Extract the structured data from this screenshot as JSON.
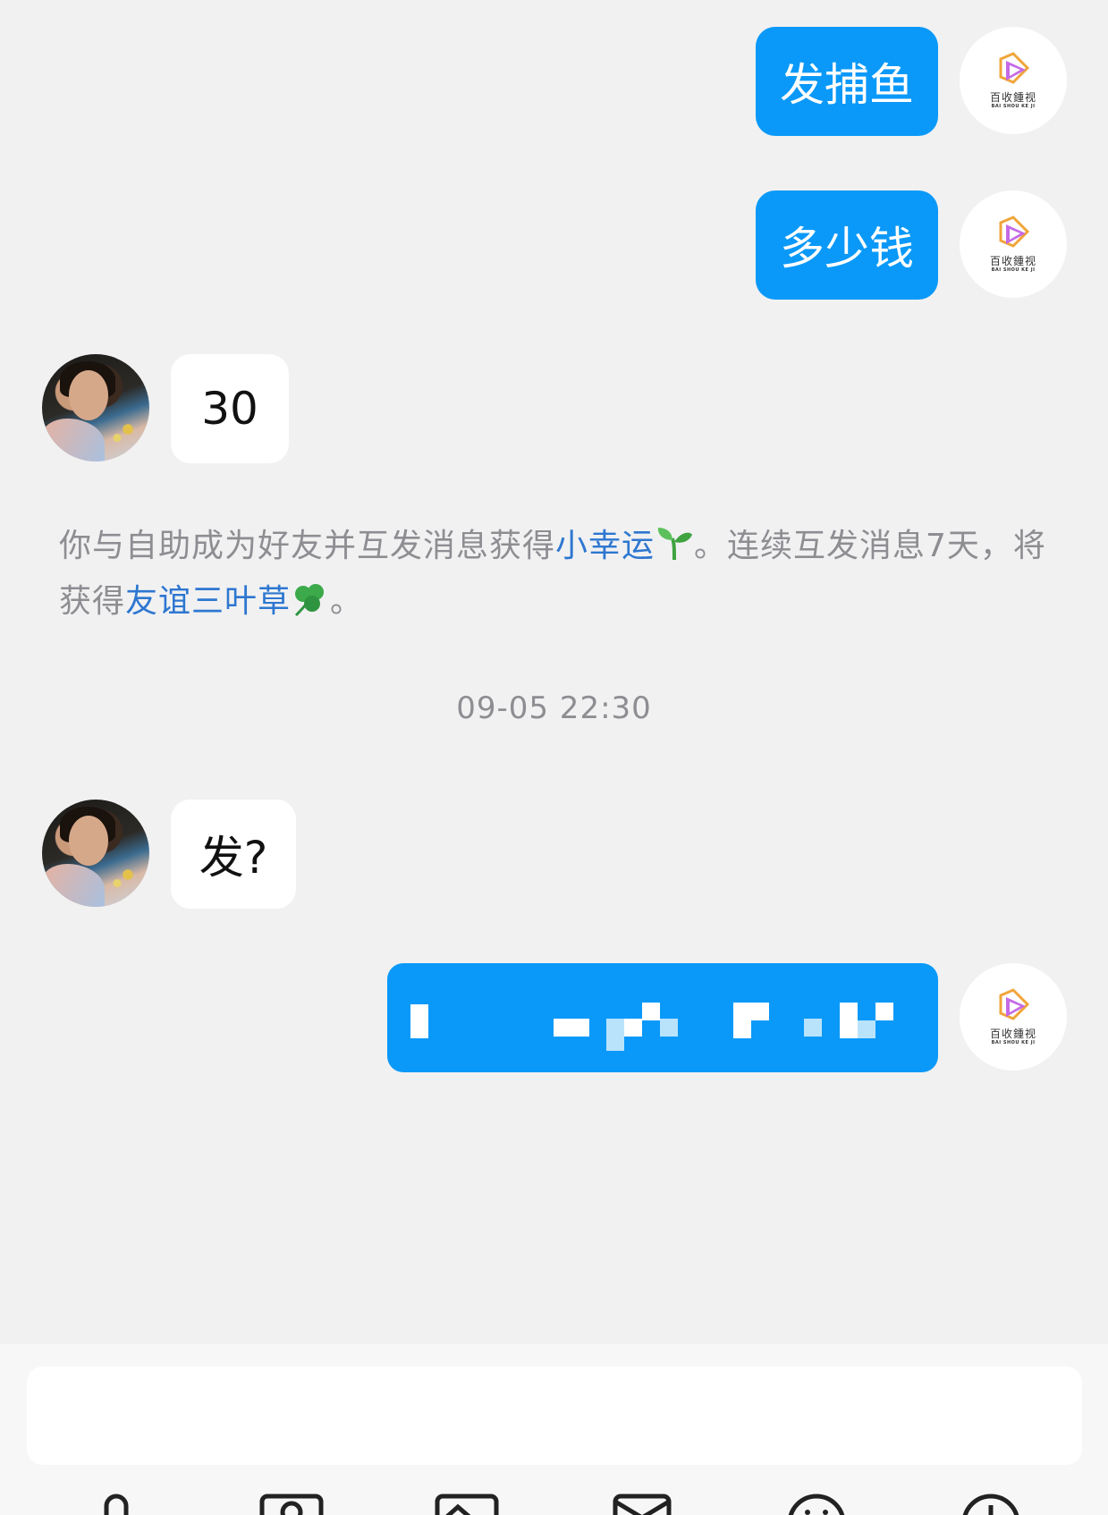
{
  "messages": [
    {
      "side": "outgoing",
      "text": "发捕鱼"
    },
    {
      "side": "outgoing",
      "text": "多少钱"
    },
    {
      "side": "incoming",
      "text": "30"
    },
    {
      "side": "incoming",
      "text": "发?"
    },
    {
      "side": "outgoing",
      "text": ""
    }
  ],
  "sender_avatar": {
    "brand_name": "百收鍾视",
    "brand_sub": "BAI SHOU KE JI"
  },
  "system_note": {
    "part1": "你与自助成为好友并互发消息获得",
    "link1": "小幸运",
    "part2": "。连续互发消息7天，将获得",
    "link2": "友谊三叶草",
    "part3": "。"
  },
  "timestamp": "09-05 22:30",
  "input": {
    "value": ""
  },
  "toolbar_icons": [
    "voice-icon",
    "photo-icon",
    "image-icon",
    "red-packet-icon",
    "emoji-icon",
    "plus-icon"
  ],
  "colors": {
    "outgoing_bubble": "#0a99f8",
    "incoming_bubble": "#ffffff",
    "background": "#f1f1f2",
    "link": "#2e77d0",
    "muted_text": "#8d8d92"
  }
}
